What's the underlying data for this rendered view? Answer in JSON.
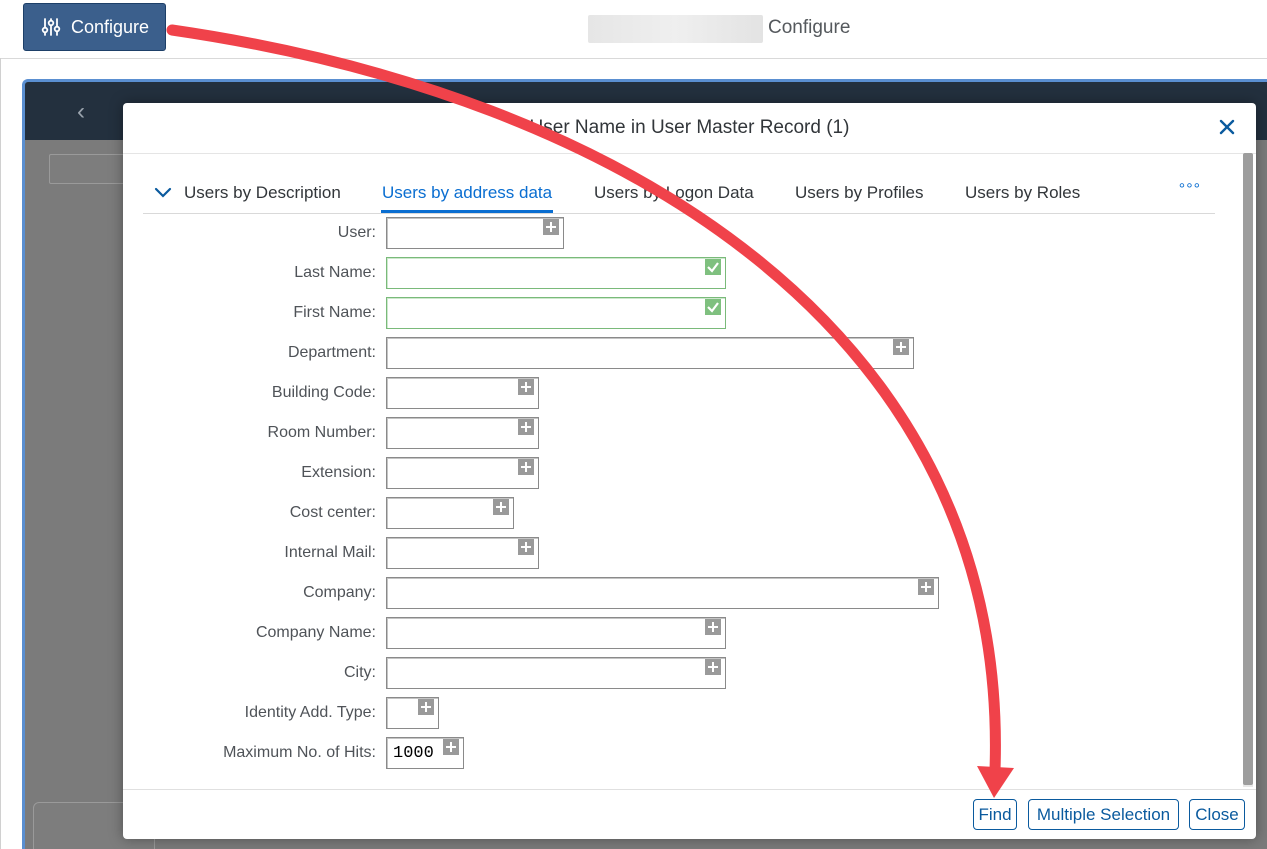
{
  "header": {
    "configure_button": "Configure",
    "page_title": "Configure"
  },
  "dialog": {
    "title": "User Name in User Master Record (1)",
    "tabs": [
      {
        "label": "Users by Description"
      },
      {
        "label": "Users by address data"
      },
      {
        "label": "Users by Logon Data"
      },
      {
        "label": "Users by Profiles"
      },
      {
        "label": "Users by Roles"
      }
    ],
    "more_label": "°°°",
    "fields": [
      {
        "label": "User:",
        "value": ""
      },
      {
        "label": "Last Name:",
        "value": ""
      },
      {
        "label": "First Name:",
        "value": ""
      },
      {
        "label": "Department:",
        "value": ""
      },
      {
        "label": "Building Code:",
        "value": ""
      },
      {
        "label": "Room Number:",
        "value": ""
      },
      {
        "label": "Extension:",
        "value": ""
      },
      {
        "label": "Cost center:",
        "value": ""
      },
      {
        "label": "Internal Mail:",
        "value": ""
      },
      {
        "label": "Company:",
        "value": ""
      },
      {
        "label": "Company Name:",
        "value": ""
      },
      {
        "label": "City:",
        "value": ""
      },
      {
        "label": "Identity Add. Type:",
        "value": ""
      },
      {
        "label": "Maximum No. of Hits:",
        "value": "1000"
      }
    ],
    "buttons": {
      "find": "Find",
      "multiple_selection": "Multiple Selection",
      "close": "Close"
    }
  },
  "colors": {
    "accent": "#0a6ed1",
    "annotation_arrow": "#f0424a",
    "valid_field": "#7fc07f"
  }
}
